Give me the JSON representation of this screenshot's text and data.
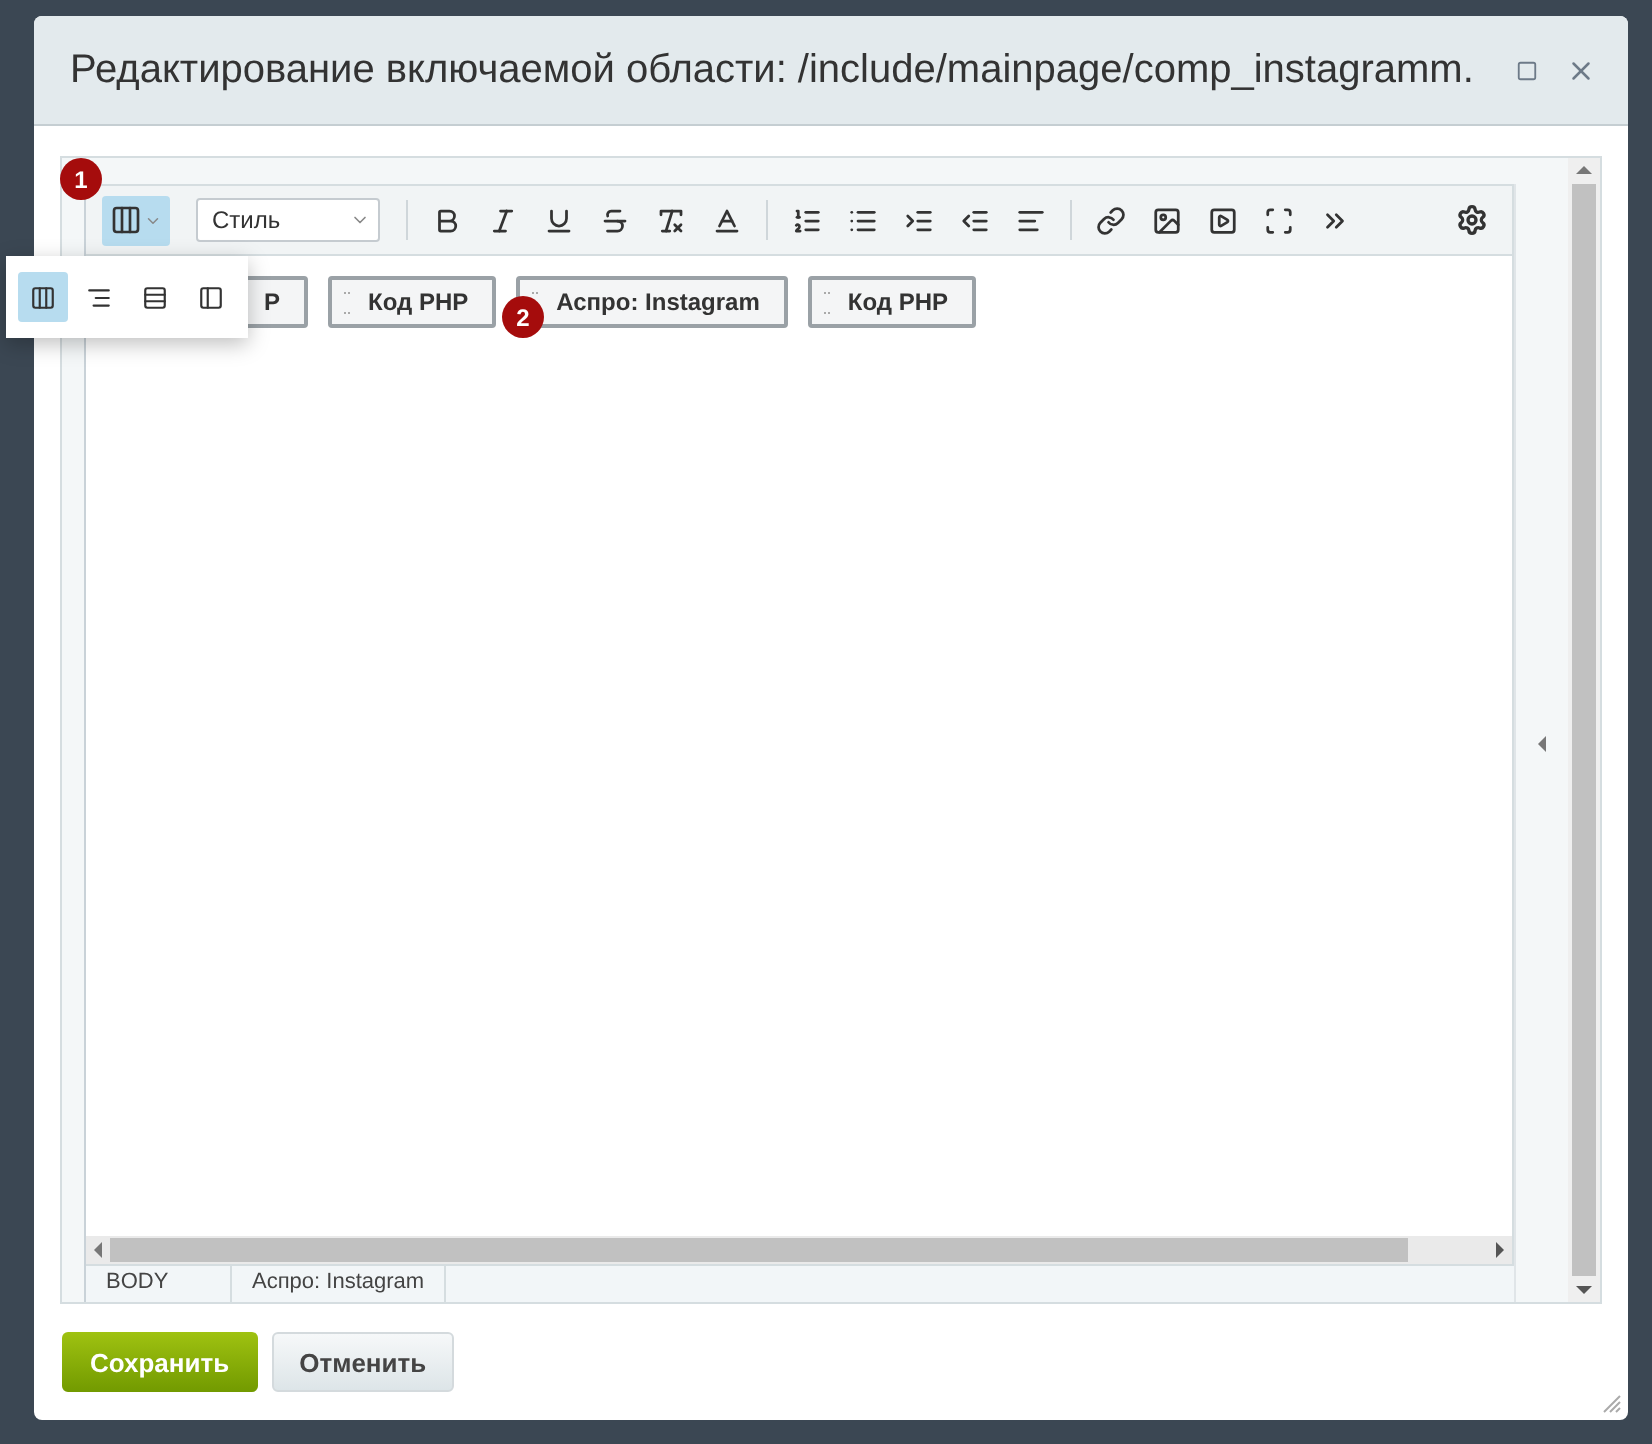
{
  "dialog": {
    "title": "Редактирование включаемой области: /include/mainpage/comp_instagramm."
  },
  "toolbar": {
    "style_select": "Стиль",
    "view_button_selected": true
  },
  "view_menu": [
    {
      "selected": true
    },
    {
      "selected": false
    },
    {
      "selected": false
    },
    {
      "selected": false
    }
  ],
  "blocks": [
    "P",
    "Код PHP",
    "Аспро: Instagram",
    "Код PHP"
  ],
  "markers": [
    "1",
    "2"
  ],
  "status_path": [
    "BODY",
    "Аспро: Instagram"
  ],
  "buttons": {
    "save": "Сохранить",
    "cancel": "Отменить"
  }
}
